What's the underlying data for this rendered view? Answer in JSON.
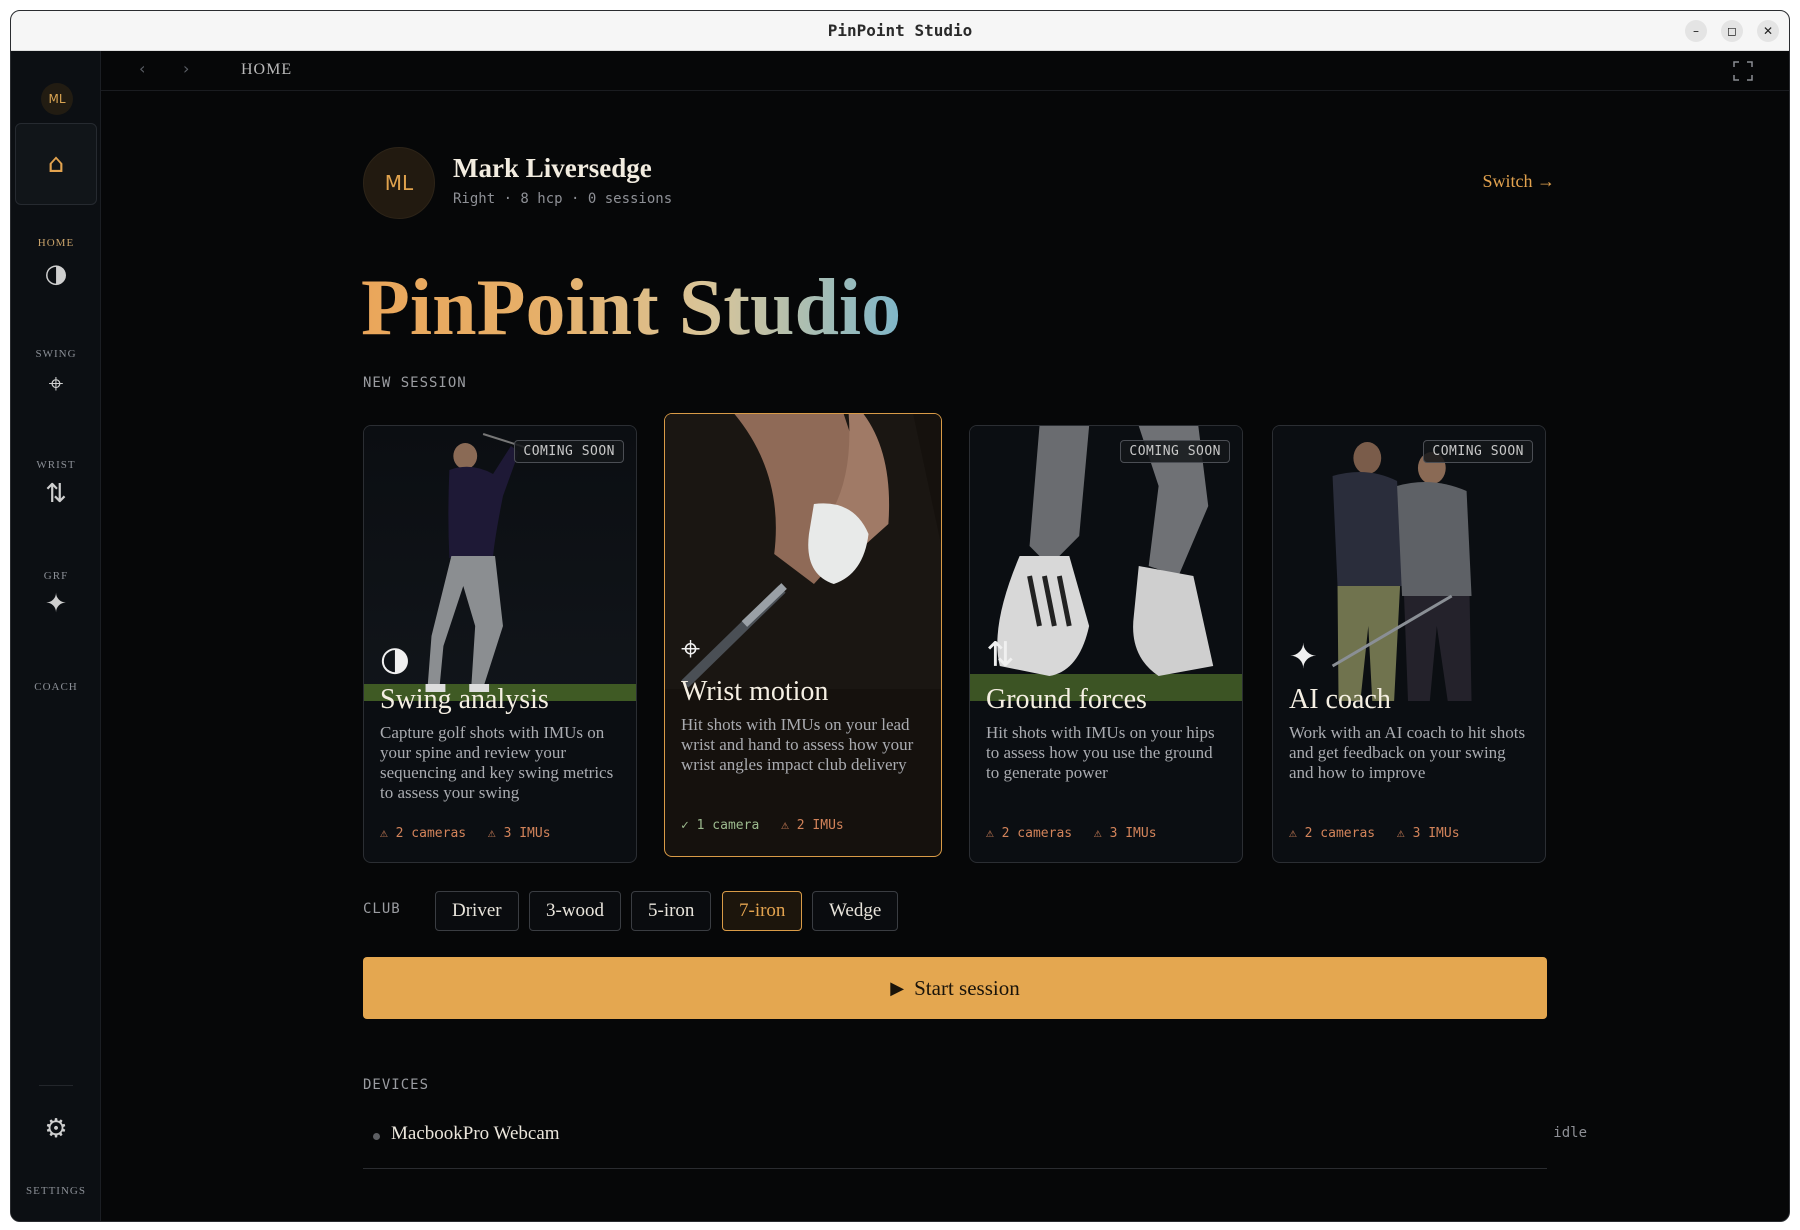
{
  "window": {
    "title": "PinPoint Studio"
  },
  "sidebar": {
    "avatar_initials": "ML",
    "items": [
      {
        "label": "HOME",
        "icon": "home-icon",
        "glyph": "⌂",
        "active": true
      },
      {
        "label": "SWING",
        "icon": "half-circle-icon",
        "glyph": "◑",
        "active": false
      },
      {
        "label": "WRIST",
        "icon": "crosshair-icon",
        "glyph": "⌖",
        "active": false
      },
      {
        "label": "GRF",
        "icon": "up-down-arrows-icon",
        "glyph": "⇅",
        "active": false
      },
      {
        "label": "COACH",
        "icon": "sparkle-icon",
        "glyph": "✦",
        "active": false
      }
    ],
    "settings": {
      "label": "SETTINGS",
      "icon": "gear-icon",
      "glyph": "⚙"
    }
  },
  "topbar": {
    "back": "‹",
    "forward": "›",
    "breadcrumb": "HOME"
  },
  "user": {
    "initials": "ML",
    "name": "Mark Liversedge",
    "meta": "Right · 8 hcp · 0 sessions",
    "switch_label": "Switch →"
  },
  "hero": {
    "title": "PinPoint Studio"
  },
  "new_session": {
    "label": "NEW SESSION",
    "cards": [
      {
        "title": "Swing analysis",
        "icon": "half-circle-icon",
        "glyph": "◑",
        "badge": "COMING SOON",
        "description": "Capture golf shots with IMUs on your spine and review your sequencing and key swing metrics to assess your swing",
        "req_cameras": "⚠ 2 cameras",
        "req_imus": "⚠ 3 IMUs",
        "selected": false
      },
      {
        "title": "Wrist motion",
        "icon": "crosshair-icon",
        "glyph": "⌖",
        "badge": "",
        "description": "Hit shots with IMUs on your lead wrist and hand to assess how your wrist angles impact club delivery",
        "req_cameras": "✓ 1 camera",
        "req_imus": "⚠ 2 IMUs",
        "selected": true
      },
      {
        "title": "Ground forces",
        "icon": "up-down-arrows-icon",
        "glyph": "⇅",
        "badge": "COMING SOON",
        "description": "Hit shots with IMUs on your hips to assess how you use the ground to generate power",
        "req_cameras": "⚠ 2 cameras",
        "req_imus": "⚠ 3 IMUs",
        "selected": false
      },
      {
        "title": "AI coach",
        "icon": "sparkle-icon",
        "glyph": "✦",
        "badge": "COMING SOON",
        "description": "Work with an AI coach to hit shots and get feedback on your swing and how to improve",
        "req_cameras": "⚠ 2 cameras",
        "req_imus": "⚠ 3 IMUs",
        "selected": false
      }
    ]
  },
  "club": {
    "label": "CLUB",
    "options": [
      "Driver",
      "3-wood",
      "5-iron",
      "7-iron",
      "Wedge"
    ],
    "selected": "7-iron"
  },
  "start_button": {
    "icon": "play-icon",
    "glyph": "▶",
    "label": "Start session"
  },
  "devices": {
    "label": "DEVICES",
    "items": [
      {
        "name": "MacbookPro Webcam",
        "status": "idle"
      }
    ]
  },
  "colors": {
    "accent": "#e4a750",
    "background": "#060708",
    "sidebar": "#0c0f13"
  }
}
